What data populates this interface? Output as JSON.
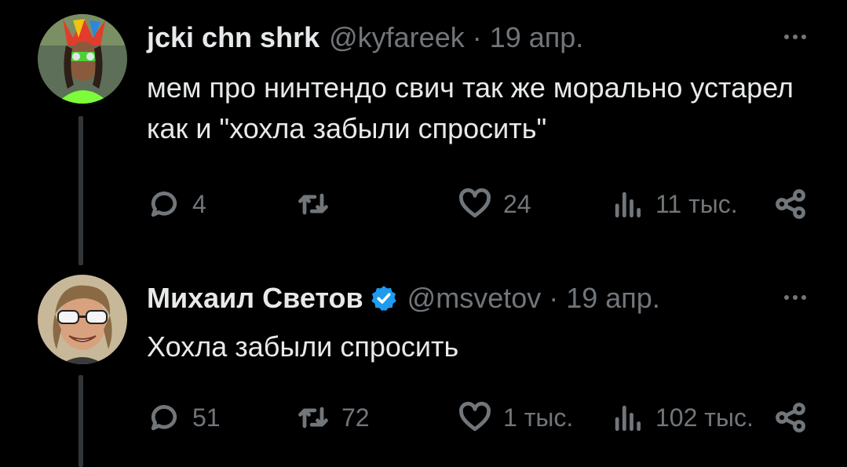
{
  "tweets": [
    {
      "author_name": "jcki chn shrk",
      "handle": "@kyfareek",
      "dot": "·",
      "date": "19 апр.",
      "text": "мем про нинтендо свич так же морально устарел как и \"хохла забыли спросить\"",
      "replies": "4",
      "retweets": "",
      "likes": "24",
      "views": "11 тыс."
    },
    {
      "author_name": "Михаил Светов",
      "handle": "@msvetov",
      "dot": "·",
      "date": "19 апр.",
      "verified": true,
      "text": "Хохла забыли спросить",
      "replies": "51",
      "retweets": "72",
      "likes": "1 тыс.",
      "views": "102 тыс."
    }
  ],
  "colors": {
    "background": "#000000",
    "text": "#e7e9ea",
    "muted": "#71767b",
    "verified": "#1d9bf0",
    "thread_line": "#333639"
  }
}
